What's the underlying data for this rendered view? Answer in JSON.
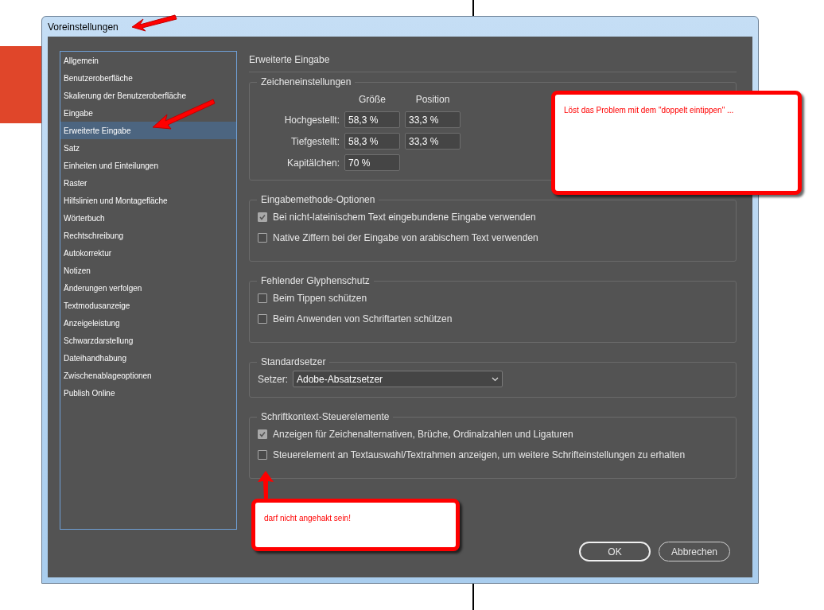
{
  "window": {
    "title": "Voreinstellungen"
  },
  "sidebar": {
    "items": [
      {
        "label": "Allgemein",
        "selected": false
      },
      {
        "label": "Benutzeroberfläche",
        "selected": false
      },
      {
        "label": "Skalierung der Benutzeroberfläche",
        "selected": false
      },
      {
        "label": "Eingabe",
        "selected": false
      },
      {
        "label": "Erweiterte Eingabe",
        "selected": true
      },
      {
        "label": "Satz",
        "selected": false
      },
      {
        "label": "Einheiten und Einteilungen",
        "selected": false
      },
      {
        "label": "Raster",
        "selected": false
      },
      {
        "label": "Hilfslinien und Montagefläche",
        "selected": false
      },
      {
        "label": "Wörterbuch",
        "selected": false
      },
      {
        "label": "Rechtschreibung",
        "selected": false
      },
      {
        "label": "Autokorrektur",
        "selected": false
      },
      {
        "label": "Notizen",
        "selected": false
      },
      {
        "label": "Änderungen verfolgen",
        "selected": false
      },
      {
        "label": "Textmodusanzeige",
        "selected": false
      },
      {
        "label": "Anzeigeleistung",
        "selected": false
      },
      {
        "label": "Schwarzdarstellung",
        "selected": false
      },
      {
        "label": "Dateihandhabung",
        "selected": false
      },
      {
        "label": "Zwischenablageoptionen",
        "selected": false
      },
      {
        "label": "Publish Online",
        "selected": false
      }
    ]
  },
  "panel": {
    "title": "Erweiterte Eingabe",
    "character_settings": {
      "title": "Zeicheneinstellungen",
      "columns": [
        "Größe",
        "Position"
      ],
      "rows": [
        {
          "label": "Hochgestellt:",
          "values": [
            "58,3 %",
            "33,3 %"
          ]
        },
        {
          "label": "Tiefgestellt:",
          "values": [
            "58,3 %",
            "33,3 %"
          ]
        },
        {
          "label": "Kapitälchen:",
          "values": [
            "70 %"
          ]
        }
      ]
    },
    "groups": [
      {
        "title": "Eingabemethode-Optionen",
        "kind": "checkboxes",
        "options": [
          {
            "label": "Bei nicht-lateinischem Text eingebundene Eingabe verwenden",
            "checked": true
          },
          {
            "label": "Native Ziffern bei der Eingabe von arabischem Text verwenden",
            "checked": false
          }
        ]
      },
      {
        "title": "Fehlender Glyphenschutz",
        "kind": "checkboxes",
        "options": [
          {
            "label": "Beim Tippen schützen",
            "checked": false
          },
          {
            "label": "Beim Anwenden von Schriftarten schützen",
            "checked": false
          }
        ]
      },
      {
        "title": "Standardsetzer",
        "kind": "dropdown",
        "label": "Setzer:",
        "value": "Adobe-Absatzsetzer"
      },
      {
        "title": "Schriftkontext-Steuerelemente",
        "kind": "checkboxes",
        "options": [
          {
            "label": "Anzeigen für Zeichenalternativen, Brüche, Ordinalzahlen und Ligaturen",
            "checked": true
          },
          {
            "label": "Steuerelement an Textauswahl/Textrahmen anzeigen, um weitere Schrifteinstellungen zu erhalten",
            "checked": false
          }
        ]
      }
    ]
  },
  "buttons": [
    {
      "label": "OK"
    },
    {
      "label": "Abbrechen"
    }
  ],
  "callouts": [
    {
      "text": "Löst das Problem mit dem \"doppelt eintippen\" ..."
    },
    {
      "text": "darf nicht angehakt sein!"
    }
  ]
}
